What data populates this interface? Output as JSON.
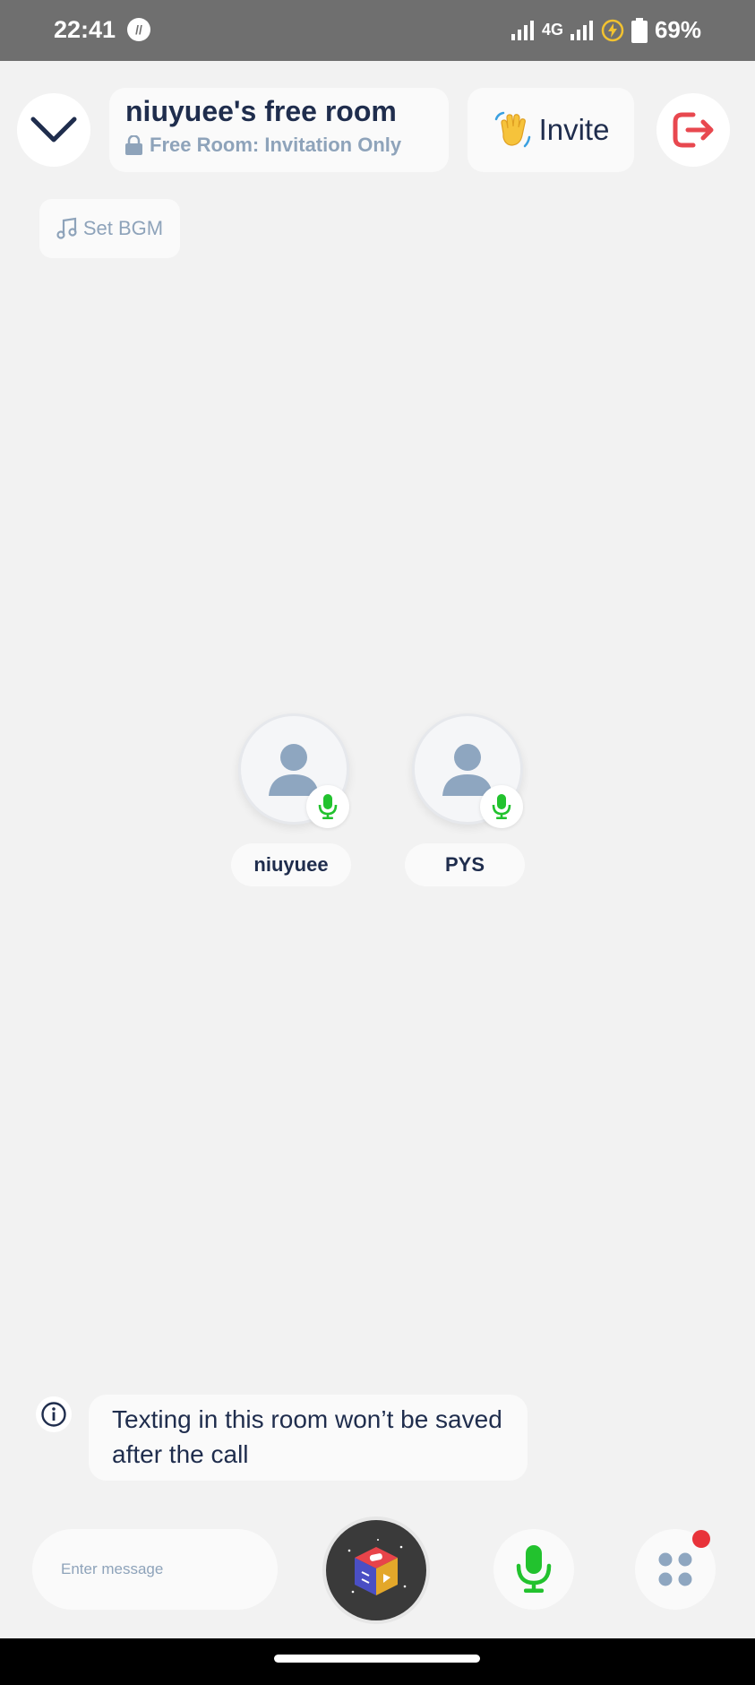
{
  "status_bar": {
    "time": "22:41",
    "app_badge": "//",
    "network": "4G",
    "battery": "69%",
    "icons": [
      "signal-icon",
      "signal-icon",
      "charging-icon",
      "battery-icon"
    ]
  },
  "header": {
    "collapse_icon": "chevron-down-icon",
    "room_title": "niuyuee's free room",
    "room_subtitle": "Free Room: Invitation Only",
    "lock_icon": "lock-icon",
    "invite_label": "Invite",
    "invite_icon": "waving-hand-icon",
    "exit_icon": "exit-icon",
    "bgm_label": "Set BGM",
    "bgm_icon": "music-note-icon"
  },
  "participants": [
    {
      "name": "niuyuee",
      "mic": "on"
    },
    {
      "name": "PYS",
      "mic": "on"
    }
  ],
  "notice": {
    "text": "Texting in this room won’t be saved after the call",
    "icon": "info-icon"
  },
  "bottom_bar": {
    "message_placeholder": "Enter message",
    "game_icon": "game-cube-icon",
    "mic_icon": "microphone-icon",
    "apps_icon": "apps-grid-icon",
    "has_notification": true
  },
  "colors": {
    "primary_text": "#1f2d4d",
    "secondary_text": "#8ea3ba",
    "mic_green": "#22c22e",
    "exit_red": "#e8484f",
    "notification_red": "#e8333a",
    "background": "#f2f2f2"
  }
}
